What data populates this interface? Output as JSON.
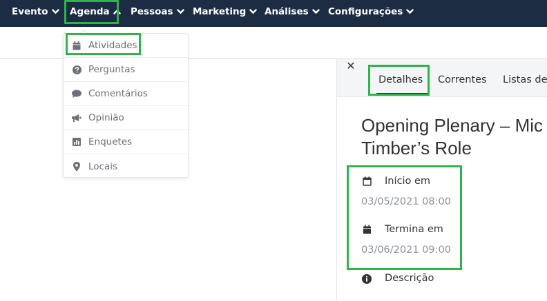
{
  "topnav": {
    "items": [
      {
        "label": "Evento"
      },
      {
        "label": "Agenda",
        "expanded": true
      },
      {
        "label": "Pessoas"
      },
      {
        "label": "Marketing"
      },
      {
        "label": "Análises"
      },
      {
        "label": "Configurações"
      }
    ],
    "background_color": "#1c2d43"
  },
  "agenda_menu": {
    "items": [
      {
        "label": "Atividades",
        "icon": "calendar-icon",
        "highlighted": true
      },
      {
        "label": "Perguntas",
        "icon": "question-circle-icon"
      },
      {
        "label": "Comentários",
        "icon": "comment-icon"
      },
      {
        "label": "Opinião",
        "icon": "megaphone-icon"
      },
      {
        "label": "Enquetes",
        "icon": "bar-chart-icon"
      },
      {
        "label": "Locais",
        "icon": "map-marker-icon"
      }
    ]
  },
  "panel": {
    "close_label": "✕",
    "tabs": [
      {
        "label": "Detalhes",
        "active": true
      },
      {
        "label": "Correntes"
      },
      {
        "label": "Listas de"
      }
    ],
    "title_line1": "Opening Plenary – Mic",
    "title_line2": "Timber’s Role",
    "start": {
      "label": "Início em",
      "value": "03/05/2021 08:00",
      "icon": "calendar-outline-icon"
    },
    "end": {
      "label": "Termina em",
      "value": "03/06/2021 09:00",
      "icon": "calendar-solid-icon"
    },
    "description": {
      "label": "Descrição",
      "icon": "info-circle-icon"
    }
  },
  "highlight_color": "#2db44a"
}
